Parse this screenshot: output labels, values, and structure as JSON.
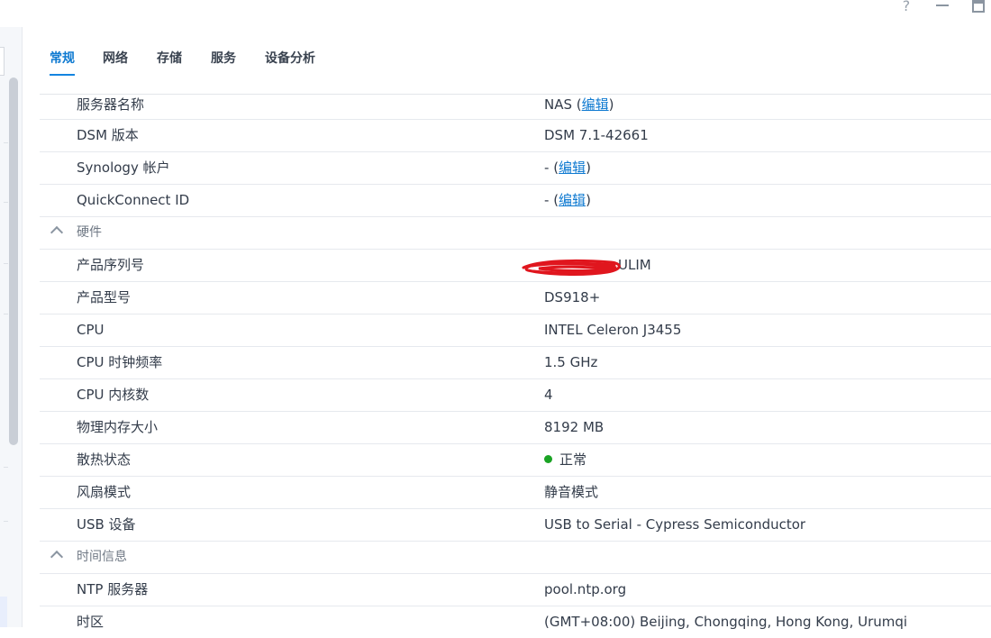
{
  "window": {
    "help_glyph": "?"
  },
  "tabs": [
    {
      "label": "常规"
    },
    {
      "label": "网络"
    },
    {
      "label": "存储"
    },
    {
      "label": "服务"
    },
    {
      "label": "设备分析"
    }
  ],
  "general": {
    "server_name_label": "服务器名称",
    "server_name_value": "NAS",
    "dsm_label": "DSM 版本",
    "dsm_value": "DSM 7.1-42661",
    "synology_label": "Synology 帐户",
    "synology_value": "-",
    "quickconnect_label": "QuickConnect ID",
    "quickconnect_value": "-",
    "edit_link": "编辑"
  },
  "hardware": {
    "section_label": "硬件",
    "serial_label": "产品序列号",
    "serial_visible_suffix": "ULIM",
    "model_label": "产品型号",
    "model_value": "DS918+",
    "cpu_label": "CPU",
    "cpu_value": "INTEL Celeron J3455",
    "cpu_clock_label": "CPU 时钟频率",
    "cpu_clock_value": "1.5 GHz",
    "cpu_cores_label": "CPU 内核数",
    "cpu_cores_value": "4",
    "memory_label": "物理内存大小",
    "memory_value": "8192 MB",
    "thermal_label": "散热状态",
    "thermal_value": "正常",
    "fan_label": "风扇模式",
    "fan_value": "静音模式",
    "usb_label": "USB 设备",
    "usb_value": "USB to Serial - Cypress Semiconductor"
  },
  "time": {
    "section_label": "时间信息",
    "ntp_label": "NTP 服务器",
    "ntp_value": "pool.ntp.org",
    "tz_label": "时区",
    "tz_value": "(GMT+08:00) Beijing, Chongqing, Hong Kong, Urumqi"
  },
  "colors": {
    "accent": "#0f7ad1",
    "ok": "#1a9b2a",
    "redaction": "#e0161e"
  },
  "icons": {
    "help": "help-icon",
    "minimize": "minimize-icon",
    "maximize": "maximize-icon",
    "section_toggle": "chevron-up-icon",
    "status": "status-dot-icon"
  }
}
